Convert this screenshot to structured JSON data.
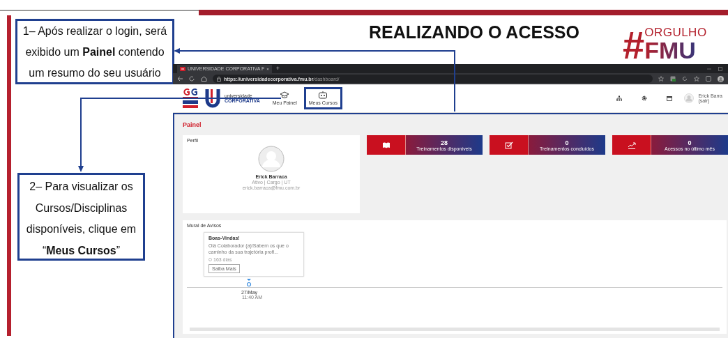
{
  "slide": {
    "title": "REALIZANDO O ACESSO",
    "logo": {
      "hash": "#",
      "top": "ORGULHO",
      "bottom": "FMU"
    },
    "callouts": [
      {
        "text": "1– Após realizar o login, será exibido um **Painel** contendo um resumo do seu usuário"
      },
      {
        "text": "2– Para visualizar os Cursos/Disciplinas disponíveis, clique em “**Meus Cursos**”"
      }
    ]
  },
  "browser": {
    "tab_title": "UNIVERSIDADE CORPORATIVA F",
    "tab_close": "×",
    "new_tab": "+",
    "url_host": "https://universidadecorporativa.fmu.br",
    "url_path": "/dashboard/"
  },
  "app": {
    "brand": {
      "top": "universidade",
      "bottom": "CORPORATIVA"
    },
    "nav": [
      {
        "label": "Meu Painel",
        "kind": "cap",
        "highlighted": false
      },
      {
        "label": "Meus Cursos",
        "kind": "robot",
        "highlighted": true
      }
    ],
    "user": {
      "name": "Erick Barra",
      "logout": "(sair)"
    },
    "page_title": "Painel",
    "profile": {
      "heading": "Perfil",
      "name": "Erick Barraca",
      "details": "Ativo | Cargo | UT",
      "email": "erick.barraca@fmu.com.br"
    },
    "stats": [
      {
        "kind": "book",
        "value": "28",
        "label": "Treinamentos disponíveis"
      },
      {
        "kind": "check",
        "value": "0",
        "label": "Treinamentos concluídos"
      },
      {
        "kind": "trend",
        "value": "0",
        "label": "Acessos no último mês"
      }
    ],
    "mural": {
      "heading": "Mural de Avisos",
      "post": {
        "title": "Boas-Vindas!",
        "text": "Olá Colaborador (a)!Sabem os que o caminho da sua trajetória profi...",
        "meta": "163 dias",
        "button": "Saiba Mais"
      },
      "date": "27/May",
      "time": "11:40 AM"
    }
  }
}
